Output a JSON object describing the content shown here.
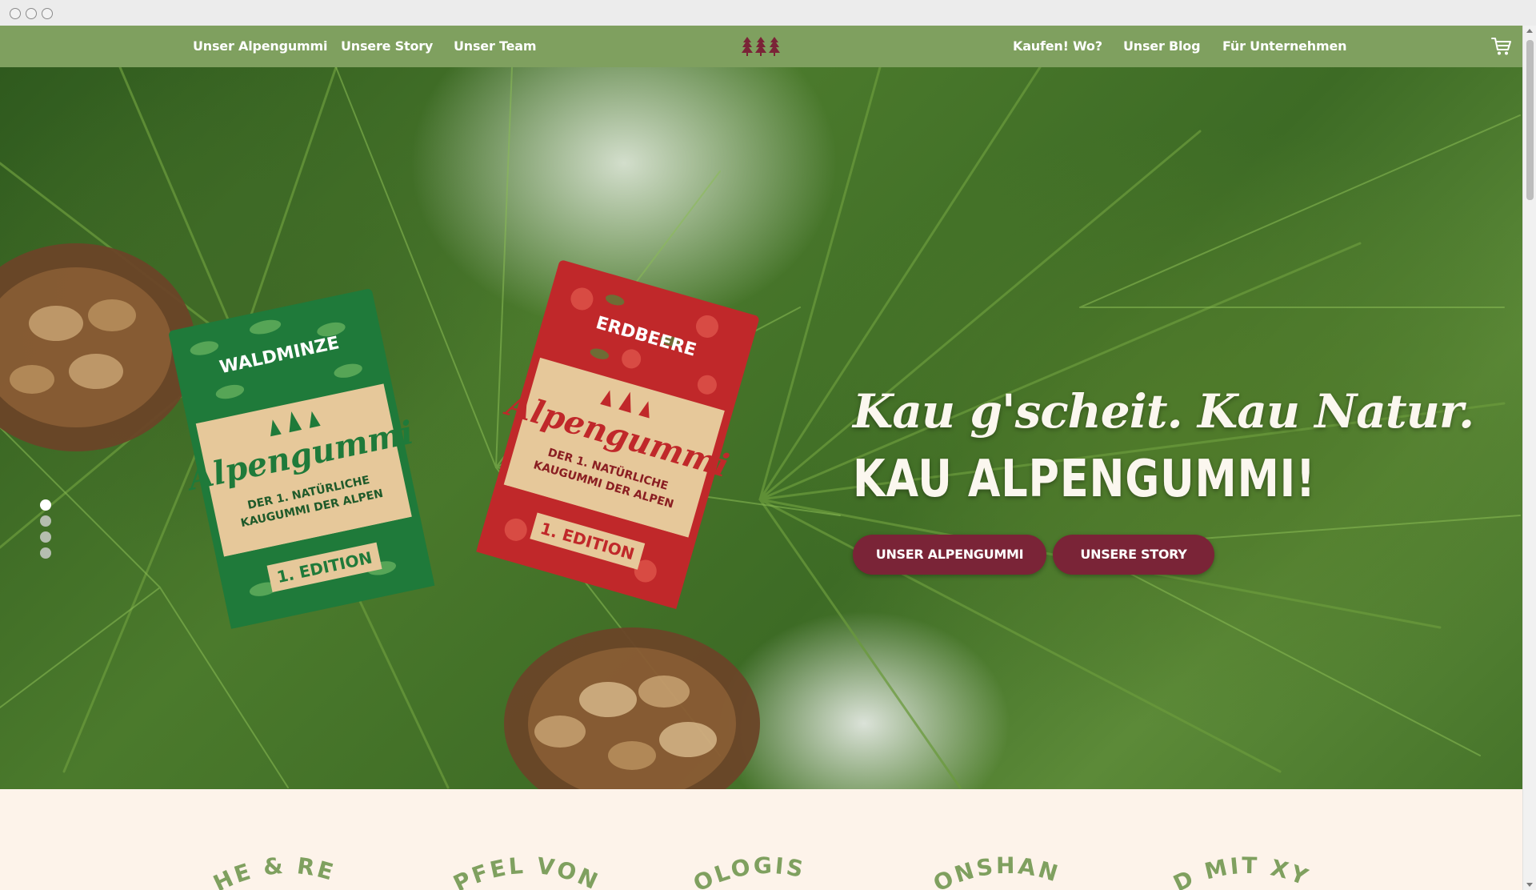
{
  "nav": {
    "left_links": [
      "Unser Alpengummi",
      "Unsere Story",
      "Unser Team"
    ],
    "right_links": [
      "Kaufen! Wo?",
      "Unser Blog",
      "Für Unternehmen"
    ],
    "logo_icon": "three-trees-logo",
    "cart_icon": "shopping-cart-icon"
  },
  "hero": {
    "tagline_script": "Kau g'scheit. Kau Natur.",
    "tagline_bold": "KAU ALPENGUMMI!",
    "buttons": [
      "UNSER ALPENGUMMI",
      "UNSERE STORY"
    ],
    "slides_total": 4,
    "slide_active": 1,
    "products": [
      {
        "flavor": "WALDMINZE",
        "brand": "Alpengummi",
        "subtitle": "DER 1. NATÜRLICHE KAUGUMMI DER ALPEN",
        "edition": "1. EDITION",
        "color": "#1f7a3a"
      },
      {
        "flavor": "ERDBEERE",
        "brand": "Alpengummi",
        "subtitle": "DER 1. NATÜRLICHE KAUGUMMI DER ALPEN",
        "edition": "1. EDITION",
        "color": "#c0282a"
      }
    ]
  },
  "features": {
    "arc_labels": [
      "...HE & RE...",
      "...PFEL VON...",
      "...OLOGIS...",
      "...ONSHAN...",
      "...D MIT XY..."
    ]
  },
  "colors": {
    "nav_green": "#7fa05f",
    "button_burgundy": "#7a2437",
    "cream": "#fdf3ea"
  }
}
